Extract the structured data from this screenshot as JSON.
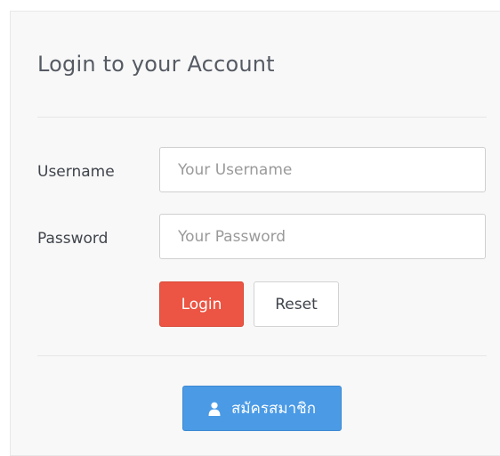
{
  "form": {
    "title": "Login to your Account",
    "username_label": "Username",
    "username_placeholder": "Your Username",
    "username_value": "",
    "password_label": "Password",
    "password_placeholder": "Your Password",
    "password_value": "",
    "login_label": "Login",
    "reset_label": "Reset",
    "register_label": "สมัครสมาชิก",
    "register_icon": "user-icon"
  },
  "colors": {
    "login_button": "#ec5543",
    "register_button": "#4a9ae6",
    "panel_background": "#f8f8f8"
  }
}
